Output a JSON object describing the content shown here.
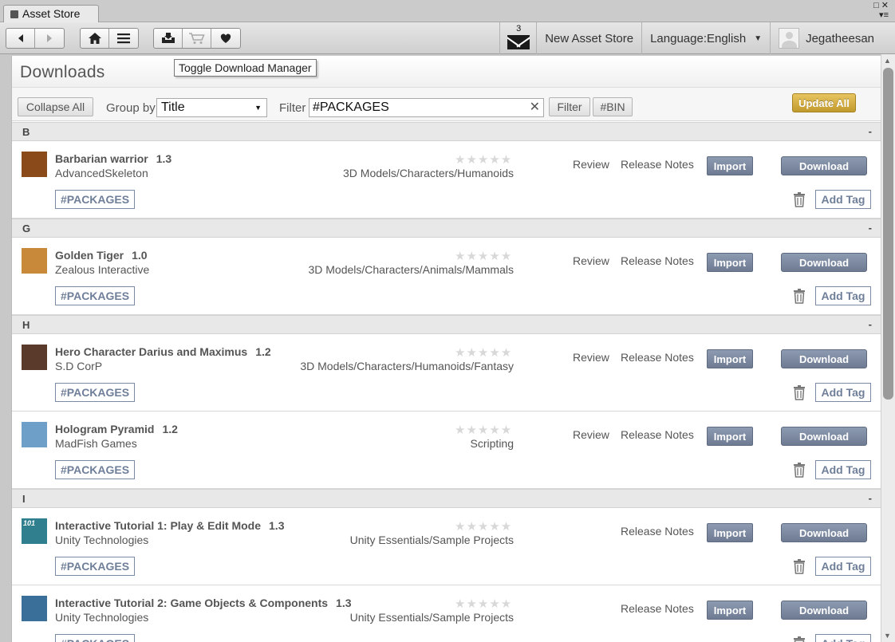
{
  "window": {
    "tab_title": "Asset Store"
  },
  "toolbar": {
    "mail_count": "3",
    "new_asset_store": "New Asset Store",
    "language": "Language:English",
    "user_name": "Jegatheesan"
  },
  "tooltip": "Toggle Download Manager",
  "header": {
    "title": "Downloads"
  },
  "filterbar": {
    "collapse_all": "Collapse All",
    "group_by_label": "Group by",
    "group_by_value": "Title",
    "filter_label": "Filter",
    "filter_value": "#PACKAGES",
    "filter_button": "Filter",
    "bin_button": "#BIN",
    "update_all": "Update All"
  },
  "common": {
    "review": "Review",
    "release_notes": "Release Notes",
    "import": "Import",
    "download": "Download",
    "add_tag": "Add Tag",
    "collapse_dash": "-",
    "stars": "★★★★★"
  },
  "sections": [
    {
      "letter": "B",
      "items": [
        {
          "name": "Barbarian warrior",
          "version": "1.3",
          "publisher": "AdvancedSkeleton",
          "category": "3D Models/Characters/Humanoids",
          "tag": "#PACKAGES",
          "has_review": true,
          "thumb_color": "#8a4a1a"
        }
      ]
    },
    {
      "letter": "G",
      "items": [
        {
          "name": "Golden Tiger",
          "version": "1.0",
          "publisher": "Zealous Interactive",
          "category": "3D Models/Characters/Animals/Mammals",
          "tag": "#PACKAGES",
          "has_review": true,
          "thumb_color": "#c8893a"
        }
      ]
    },
    {
      "letter": "H",
      "items": [
        {
          "name": "Hero Character Darius and Maximus",
          "version": "1.2",
          "publisher": "S.D CorP",
          "category": "3D Models/Characters/Humanoids/Fantasy",
          "tag": "#PACKAGES",
          "has_review": true,
          "thumb_color": "#5a3a2a"
        },
        {
          "name": "Hologram Pyramid",
          "version": "1.2",
          "publisher": "MadFish Games",
          "category": "Scripting",
          "tag": "#PACKAGES",
          "has_review": true,
          "thumb_color": "#6d9fc8"
        }
      ]
    },
    {
      "letter": "I",
      "items": [
        {
          "name": "Interactive Tutorial 1: Play & Edit Mode",
          "version": "1.3",
          "publisher": "Unity Technologies",
          "category": "Unity Essentials/Sample Projects",
          "tag": "#PACKAGES",
          "has_review": false,
          "thumb_color": "#2f7f8f",
          "thumb_text": "101"
        },
        {
          "name": "Interactive Tutorial 2: Game Objects & Components",
          "version": "1.3",
          "publisher": "Unity Technologies",
          "category": "Unity Essentials/Sample Projects",
          "tag": "#PACKAGES",
          "has_review": false,
          "thumb_color": "#3a6f9a"
        }
      ]
    }
  ],
  "icons": {
    "back": "back-arrow-icon",
    "forward": "forward-arrow-icon",
    "home": "home-icon",
    "menu": "menu-icon",
    "downloads": "download-manager-icon",
    "cart": "cart-icon",
    "wishlist": "heart-icon",
    "mail": "mail-icon",
    "trash": "trash-icon"
  },
  "colors": {
    "accent_button": "#7a879e",
    "update_button": "#d4af44"
  }
}
